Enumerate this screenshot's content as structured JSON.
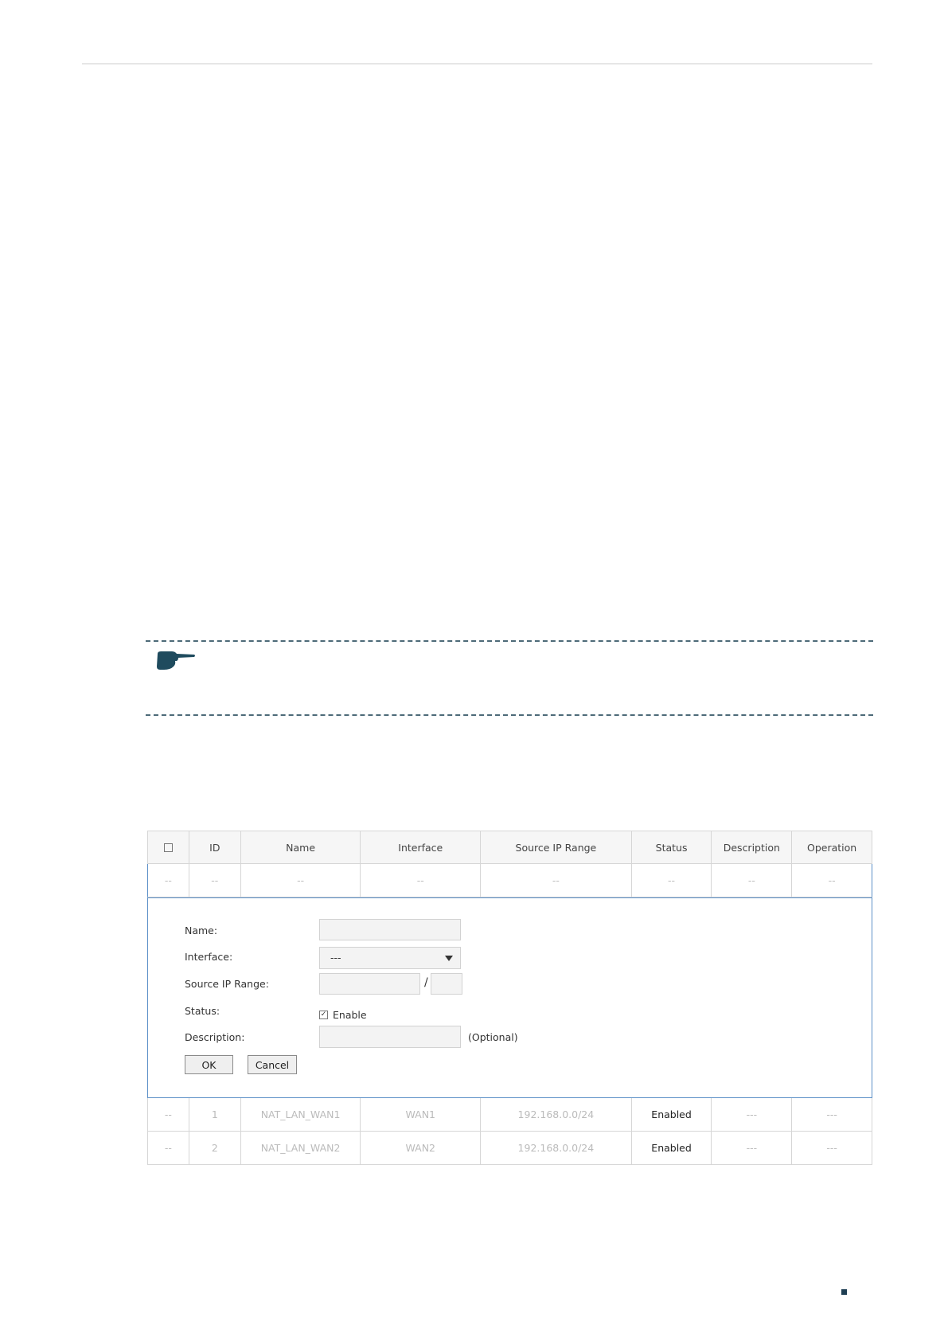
{
  "table": {
    "headers": [
      "ID",
      "Name",
      "Interface",
      "Source IP Range",
      "Status",
      "Description",
      "Operation"
    ],
    "empty_row": [
      "--",
      "--",
      "--",
      "--",
      "--",
      "--",
      "--",
      "--"
    ],
    "rows": [
      [
        "--",
        "1",
        "NAT_LAN_WAN1",
        "WAN1",
        "192.168.0.0/24",
        "Enabled",
        "---",
        "---"
      ],
      [
        "--",
        "2",
        "NAT_LAN_WAN2",
        "WAN2",
        "192.168.0.0/24",
        "Enabled",
        "---",
        "---"
      ]
    ]
  },
  "form": {
    "name_label": "Name:",
    "interface_label": "Interface:",
    "interface_value": "---",
    "source_ip_label": "Source IP Range:",
    "slash": "/",
    "status_label": "Status:",
    "status_option": "Enable",
    "status_checked": true,
    "description_label": "Description:",
    "description_hint": "(Optional)",
    "ok_label": "OK",
    "cancel_label": "Cancel"
  },
  "icons": {
    "note": "pointing-hand-icon",
    "checkbox_mark": "✓"
  },
  "colors": {
    "accent": "#5b8fc7",
    "note_icon": "#1f4b5e"
  }
}
